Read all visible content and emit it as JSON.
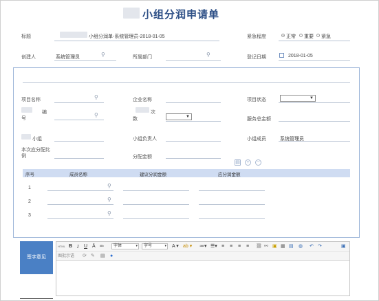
{
  "header": {
    "title": "小组分润申请单"
  },
  "top_fields": {
    "title_label": "标题",
    "title_value": "小组分润单-系统管理员-2018-01-05",
    "urgency_label": "紧急程度",
    "urgency_options": [
      {
        "label": "正常",
        "selected": true
      },
      {
        "label": "重要",
        "selected": false
      },
      {
        "label": "紧急",
        "selected": false
      }
    ],
    "creator_label": "创建人",
    "creator_value": "系统管理员",
    "dept_label": "所属部门",
    "dept_value": "",
    "date_label": "登记日期",
    "date_value": "2018-01-05"
  },
  "form": {
    "project_name_label": "项目名称",
    "company_name_label": "企业名称",
    "project_status_label": "项目状态",
    "number_label_a": "编",
    "number_label_b": "号",
    "times_label_a": "次",
    "times_label_b": "数",
    "service_total_label": "服务总金额",
    "group_label": "小组",
    "group_leader_label": "小组负责人",
    "group_members_label": "小组成员",
    "group_members_value": "系统管理员",
    "distribute_label_a": "本次应分配比",
    "distribute_label_b": "例",
    "distribute_amount_label": "分配金额"
  },
  "members_table": {
    "columns": [
      "序号",
      "成员名称",
      "建议分润金额",
      "应分润金额"
    ],
    "rows": [
      {
        "no": "1"
      },
      {
        "no": "2"
      },
      {
        "no": "3"
      }
    ]
  },
  "editor": {
    "label": "签字意见",
    "font_select": "字体",
    "size_select": "字号",
    "html_label": "HTML",
    "toolbar_row2_text": "图批示语"
  },
  "colors": {
    "title": "#2d4f86",
    "table_header": "#cfdcf2",
    "editor_label_bg": "#4a80c5"
  }
}
